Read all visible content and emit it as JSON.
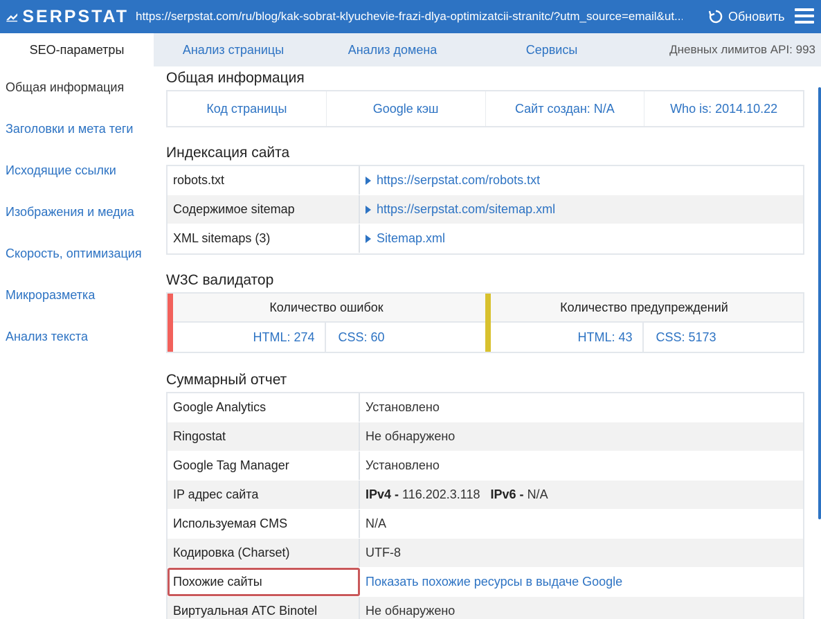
{
  "header": {
    "brand": "SERPSTAT",
    "url": "https://serpstat.com/ru/blog/kak-sobrat-klyuchevie-frazi-dlya-optimizatcii-stranitc/?utm_source=email&ut...",
    "refresh_label": "Обновить"
  },
  "tabs": [
    {
      "label": "SEO-параметры"
    },
    {
      "label": "Анализ страницы"
    },
    {
      "label": "Анализ домена"
    },
    {
      "label": "Сервисы"
    }
  ],
  "api_limits": "Дневных лимитов API: 993",
  "sidebar": {
    "items": [
      {
        "label": "Общая информация"
      },
      {
        "label": "Заголовки и мета теги"
      },
      {
        "label": "Исходящие ссылки"
      },
      {
        "label": "Изображения и медиа"
      },
      {
        "label": "Скорость, оптимизация"
      },
      {
        "label": "Микроразметка"
      },
      {
        "label": "Анализ текста"
      }
    ]
  },
  "general": {
    "title": "Общая информация",
    "cells": [
      "Код страницы",
      "Google кэш",
      "Сайт создан: N/A",
      "Who is: 2014.10.22"
    ]
  },
  "indexing": {
    "title": "Индексация сайта",
    "rows": [
      {
        "key": "robots.txt",
        "value": "https://serpstat.com/robots.txt"
      },
      {
        "key": "Содержимое sitemap",
        "value": "https://serpstat.com/sitemap.xml"
      },
      {
        "key": "XML sitemaps (3)",
        "value": "Sitemap.xml"
      }
    ]
  },
  "w3c": {
    "title": "W3C валидатор",
    "errors": {
      "label": "Количество ошибок",
      "html": "HTML: 274",
      "css": "CSS: 60",
      "color": "#f2615b"
    },
    "warnings": {
      "label": "Количество предупреждений",
      "html": "HTML: 43",
      "css": "CSS: 5173",
      "color": "#d8c12e"
    }
  },
  "summary": {
    "title": "Суммарный отчет",
    "rows": [
      {
        "key": "Google Analytics",
        "value": "Установлено"
      },
      {
        "key": "Ringostat",
        "value": "Не обнаружено"
      },
      {
        "key": "Google Tag Manager",
        "value": "Установлено"
      },
      {
        "key": "IP адрес сайта",
        "ipv4_label": "IPv4 -",
        "ipv4": "116.202.3.118",
        "ipv6_label": "IPv6 -",
        "ipv6": "N/A"
      },
      {
        "key": "Используемая CMS",
        "value": "N/A"
      },
      {
        "key": "Кодировка (Charset)",
        "value": "UTF-8"
      },
      {
        "key": "Похожие сайты",
        "value": "Показать похожие ресурсы в выдаче Google"
      },
      {
        "key": "Виртуальная АТС Binotel",
        "value": "Не обнаружено"
      }
    ]
  }
}
